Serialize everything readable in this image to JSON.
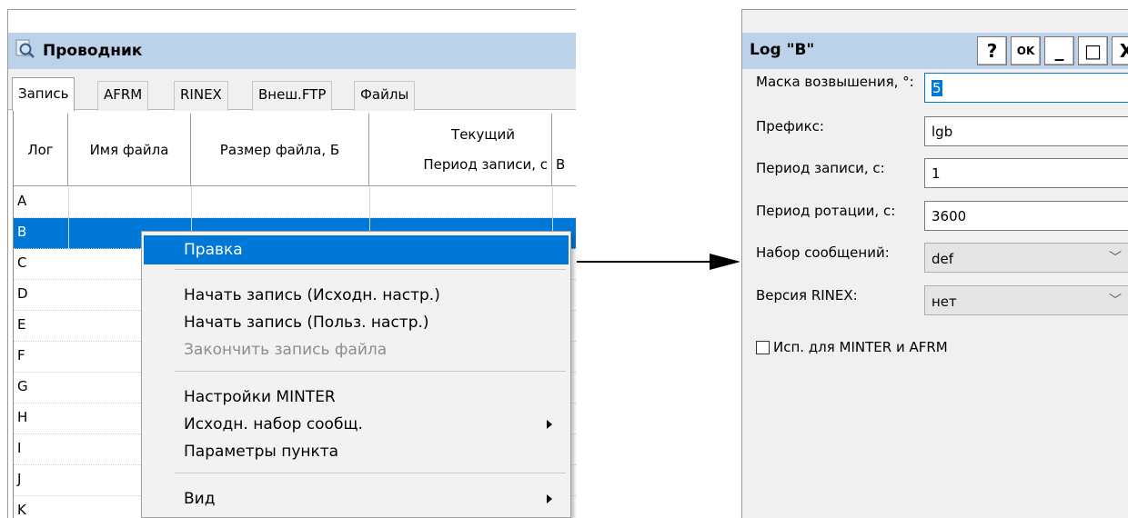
{
  "explorer": {
    "title": "Проводник",
    "icon": "search-icon",
    "tabs": [
      "Запись",
      "AFRM",
      "RINEX",
      "Внеш.FTP",
      "Файлы"
    ],
    "active_tab": "Запись",
    "columns": {
      "log": "Лог",
      "filename": "Имя файла",
      "filesize": "Размер файла, Б",
      "current_line1": "Текущий",
      "current_line2": "Период записи, с",
      "truncated": "В"
    },
    "rows": [
      "A",
      "B",
      "C",
      "D",
      "E",
      "F",
      "G",
      "H",
      "I",
      "J",
      "K"
    ],
    "selected_row": "B"
  },
  "context_menu": {
    "items": [
      {
        "label": "Правка",
        "state": "highlighted"
      },
      {
        "label": "Начать запись (Исходн. настр.)",
        "state": "normal"
      },
      {
        "label": "Начать запись (Польз. настр.)",
        "state": "normal"
      },
      {
        "label": "Закончить запись файла",
        "state": "disabled"
      },
      {
        "label": "Настройки MINTER",
        "state": "normal"
      },
      {
        "label": "Исходн. набор сообщ.",
        "state": "submenu"
      },
      {
        "label": "Параметры пункта",
        "state": "normal"
      },
      {
        "label": "Вид",
        "state": "submenu"
      }
    ]
  },
  "dialog": {
    "title": "Log \"B\"",
    "buttons": {
      "help": "?",
      "ok": "OK",
      "minimize": "_",
      "maximize": "□",
      "close": "X"
    },
    "fields": {
      "elevation_mask": {
        "label": "Маска возвышения, °:",
        "value": "5"
      },
      "prefix": {
        "label": "Префикс:",
        "value": "lgb"
      },
      "record_period": {
        "label": "Период записи, с:",
        "value": "1"
      },
      "rotation_period": {
        "label": "Период ротации, с:",
        "value": "3600"
      },
      "message_set": {
        "label": "Набор сообщений:",
        "value": "def"
      },
      "rinex_version": {
        "label": "Версия RINEX:",
        "value": "нет"
      }
    },
    "checkbox": {
      "label": "Исп. для MINTER и AFRM",
      "checked": false
    }
  },
  "colors": {
    "title_bar": "#bcd2ea",
    "selection": "#0078d7",
    "menu_bg": "#f2f2f2"
  }
}
